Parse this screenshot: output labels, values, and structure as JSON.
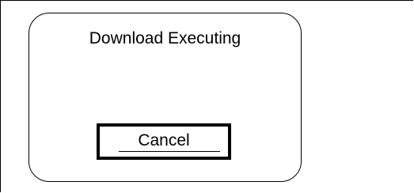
{
  "dialog": {
    "title": "Download Executing",
    "cancel_label": "Cancel"
  }
}
